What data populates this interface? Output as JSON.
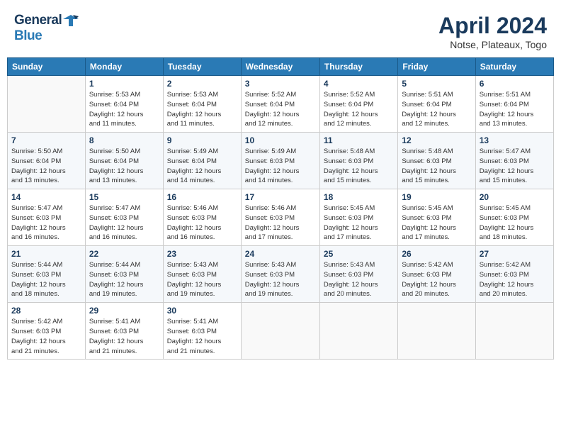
{
  "header": {
    "logo_general": "General",
    "logo_blue": "Blue",
    "month_title": "April 2024",
    "subtitle": "Notse, Plateaux, Togo"
  },
  "days_of_week": [
    "Sunday",
    "Monday",
    "Tuesday",
    "Wednesday",
    "Thursday",
    "Friday",
    "Saturday"
  ],
  "weeks": [
    [
      {
        "day": "",
        "info": ""
      },
      {
        "day": "1",
        "info": "Sunrise: 5:53 AM\nSunset: 6:04 PM\nDaylight: 12 hours\nand 11 minutes."
      },
      {
        "day": "2",
        "info": "Sunrise: 5:53 AM\nSunset: 6:04 PM\nDaylight: 12 hours\nand 11 minutes."
      },
      {
        "day": "3",
        "info": "Sunrise: 5:52 AM\nSunset: 6:04 PM\nDaylight: 12 hours\nand 12 minutes."
      },
      {
        "day": "4",
        "info": "Sunrise: 5:52 AM\nSunset: 6:04 PM\nDaylight: 12 hours\nand 12 minutes."
      },
      {
        "day": "5",
        "info": "Sunrise: 5:51 AM\nSunset: 6:04 PM\nDaylight: 12 hours\nand 12 minutes."
      },
      {
        "day": "6",
        "info": "Sunrise: 5:51 AM\nSunset: 6:04 PM\nDaylight: 12 hours\nand 13 minutes."
      }
    ],
    [
      {
        "day": "7",
        "info": "Sunrise: 5:50 AM\nSunset: 6:04 PM\nDaylight: 12 hours\nand 13 minutes."
      },
      {
        "day": "8",
        "info": "Sunrise: 5:50 AM\nSunset: 6:04 PM\nDaylight: 12 hours\nand 13 minutes."
      },
      {
        "day": "9",
        "info": "Sunrise: 5:49 AM\nSunset: 6:04 PM\nDaylight: 12 hours\nand 14 minutes."
      },
      {
        "day": "10",
        "info": "Sunrise: 5:49 AM\nSunset: 6:03 PM\nDaylight: 12 hours\nand 14 minutes."
      },
      {
        "day": "11",
        "info": "Sunrise: 5:48 AM\nSunset: 6:03 PM\nDaylight: 12 hours\nand 15 minutes."
      },
      {
        "day": "12",
        "info": "Sunrise: 5:48 AM\nSunset: 6:03 PM\nDaylight: 12 hours\nand 15 minutes."
      },
      {
        "day": "13",
        "info": "Sunrise: 5:47 AM\nSunset: 6:03 PM\nDaylight: 12 hours\nand 15 minutes."
      }
    ],
    [
      {
        "day": "14",
        "info": "Sunrise: 5:47 AM\nSunset: 6:03 PM\nDaylight: 12 hours\nand 16 minutes."
      },
      {
        "day": "15",
        "info": "Sunrise: 5:47 AM\nSunset: 6:03 PM\nDaylight: 12 hours\nand 16 minutes."
      },
      {
        "day": "16",
        "info": "Sunrise: 5:46 AM\nSunset: 6:03 PM\nDaylight: 12 hours\nand 16 minutes."
      },
      {
        "day": "17",
        "info": "Sunrise: 5:46 AM\nSunset: 6:03 PM\nDaylight: 12 hours\nand 17 minutes."
      },
      {
        "day": "18",
        "info": "Sunrise: 5:45 AM\nSunset: 6:03 PM\nDaylight: 12 hours\nand 17 minutes."
      },
      {
        "day": "19",
        "info": "Sunrise: 5:45 AM\nSunset: 6:03 PM\nDaylight: 12 hours\nand 17 minutes."
      },
      {
        "day": "20",
        "info": "Sunrise: 5:45 AM\nSunset: 6:03 PM\nDaylight: 12 hours\nand 18 minutes."
      }
    ],
    [
      {
        "day": "21",
        "info": "Sunrise: 5:44 AM\nSunset: 6:03 PM\nDaylight: 12 hours\nand 18 minutes."
      },
      {
        "day": "22",
        "info": "Sunrise: 5:44 AM\nSunset: 6:03 PM\nDaylight: 12 hours\nand 19 minutes."
      },
      {
        "day": "23",
        "info": "Sunrise: 5:43 AM\nSunset: 6:03 PM\nDaylight: 12 hours\nand 19 minutes."
      },
      {
        "day": "24",
        "info": "Sunrise: 5:43 AM\nSunset: 6:03 PM\nDaylight: 12 hours\nand 19 minutes."
      },
      {
        "day": "25",
        "info": "Sunrise: 5:43 AM\nSunset: 6:03 PM\nDaylight: 12 hours\nand 20 minutes."
      },
      {
        "day": "26",
        "info": "Sunrise: 5:42 AM\nSunset: 6:03 PM\nDaylight: 12 hours\nand 20 minutes."
      },
      {
        "day": "27",
        "info": "Sunrise: 5:42 AM\nSunset: 6:03 PM\nDaylight: 12 hours\nand 20 minutes."
      }
    ],
    [
      {
        "day": "28",
        "info": "Sunrise: 5:42 AM\nSunset: 6:03 PM\nDaylight: 12 hours\nand 21 minutes."
      },
      {
        "day": "29",
        "info": "Sunrise: 5:41 AM\nSunset: 6:03 PM\nDaylight: 12 hours\nand 21 minutes."
      },
      {
        "day": "30",
        "info": "Sunrise: 5:41 AM\nSunset: 6:03 PM\nDaylight: 12 hours\nand 21 minutes."
      },
      {
        "day": "",
        "info": ""
      },
      {
        "day": "",
        "info": ""
      },
      {
        "day": "",
        "info": ""
      },
      {
        "day": "",
        "info": ""
      }
    ]
  ]
}
